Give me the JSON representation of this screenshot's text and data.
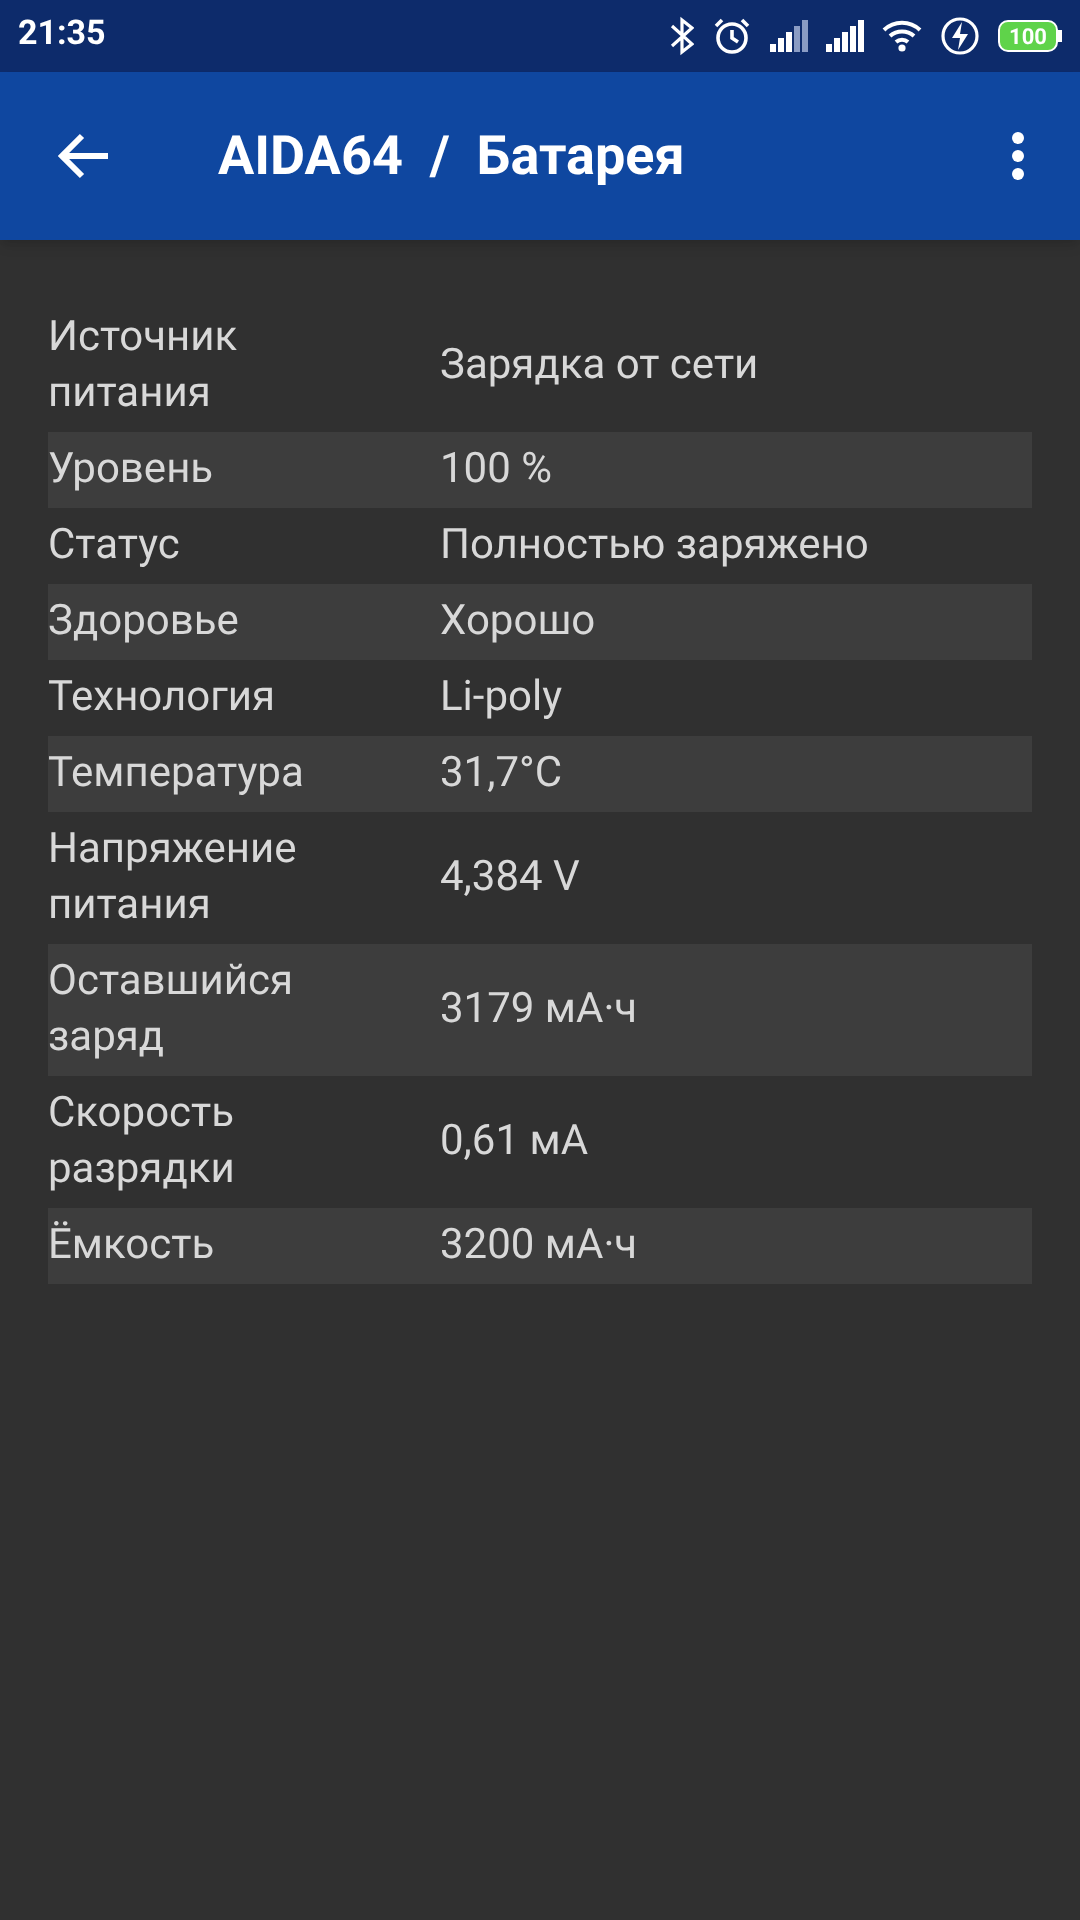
{
  "status_bar": {
    "time": "21:35",
    "battery_level": "100"
  },
  "app_bar": {
    "title": "AIDA64  /  Батарея"
  },
  "rows": [
    {
      "label": "Источник питания",
      "value": "Зарядка от сети"
    },
    {
      "label": "Уровень",
      "value": "100 %"
    },
    {
      "label": "Статус",
      "value": "Полностью заряжено"
    },
    {
      "label": "Здоровье",
      "value": "Хорошо"
    },
    {
      "label": "Технология",
      "value": "Li-poly"
    },
    {
      "label": "Температура",
      "value": "31,7°C"
    },
    {
      "label": "Напряжение питания",
      "value": "4,384 V"
    },
    {
      "label": "Оставшийся заряд",
      "value": "3179 мА·ч"
    },
    {
      "label": "Скорость разрядки",
      "value": "0,61 мА"
    },
    {
      "label": "Ёмкость",
      "value": "3200 мА·ч"
    }
  ]
}
